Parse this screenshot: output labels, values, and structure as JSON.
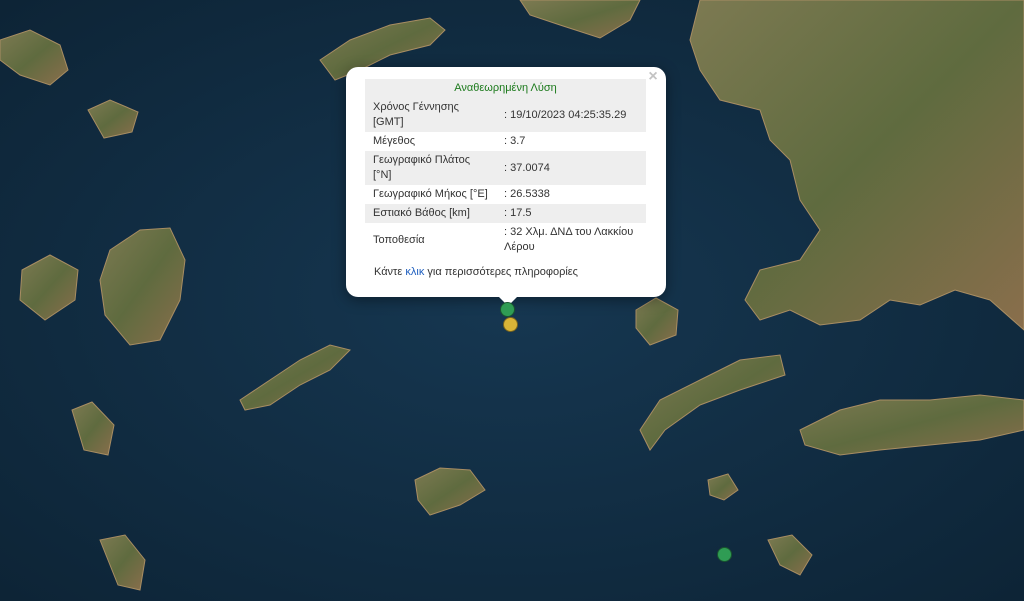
{
  "popup": {
    "title": "Αναθεωρημένη Λύση",
    "close_symbol": "×",
    "rows": [
      {
        "label": "Χρόνος Γέννησης [GMT]",
        "value": ": 19/10/2023 04:25:35.29"
      },
      {
        "label": "Μέγεθος",
        "value": ": 3.7"
      },
      {
        "label": "Γεωγραφικό Πλάτος [°N]",
        "value": ": 37.0074"
      },
      {
        "label": "Γεωγραφικό Μήκος [°E]",
        "value": ": 26.5338"
      },
      {
        "label": "Εστιακό Βάθος [km]",
        "value": ": 17.5"
      },
      {
        "label": "Τοποθεσία",
        "value": ": 32 Χλμ. ΔΝΔ του Λακκίου Λέρου"
      }
    ],
    "more_prefix": "Κάντε ",
    "more_link": "κλικ",
    "more_suffix": " για περισσότερες πληροφορίες"
  },
  "colors": {
    "sea": "#12304a",
    "land": "#6b6a45",
    "marker_green": "#2f9c54",
    "marker_yellow": "#d8b437"
  },
  "markers": [
    {
      "name": "earthquake-marker-green",
      "color": "green"
    },
    {
      "name": "earthquake-marker-yellow",
      "color": "yellow"
    },
    {
      "name": "earthquake-marker-green",
      "color": "green"
    }
  ]
}
